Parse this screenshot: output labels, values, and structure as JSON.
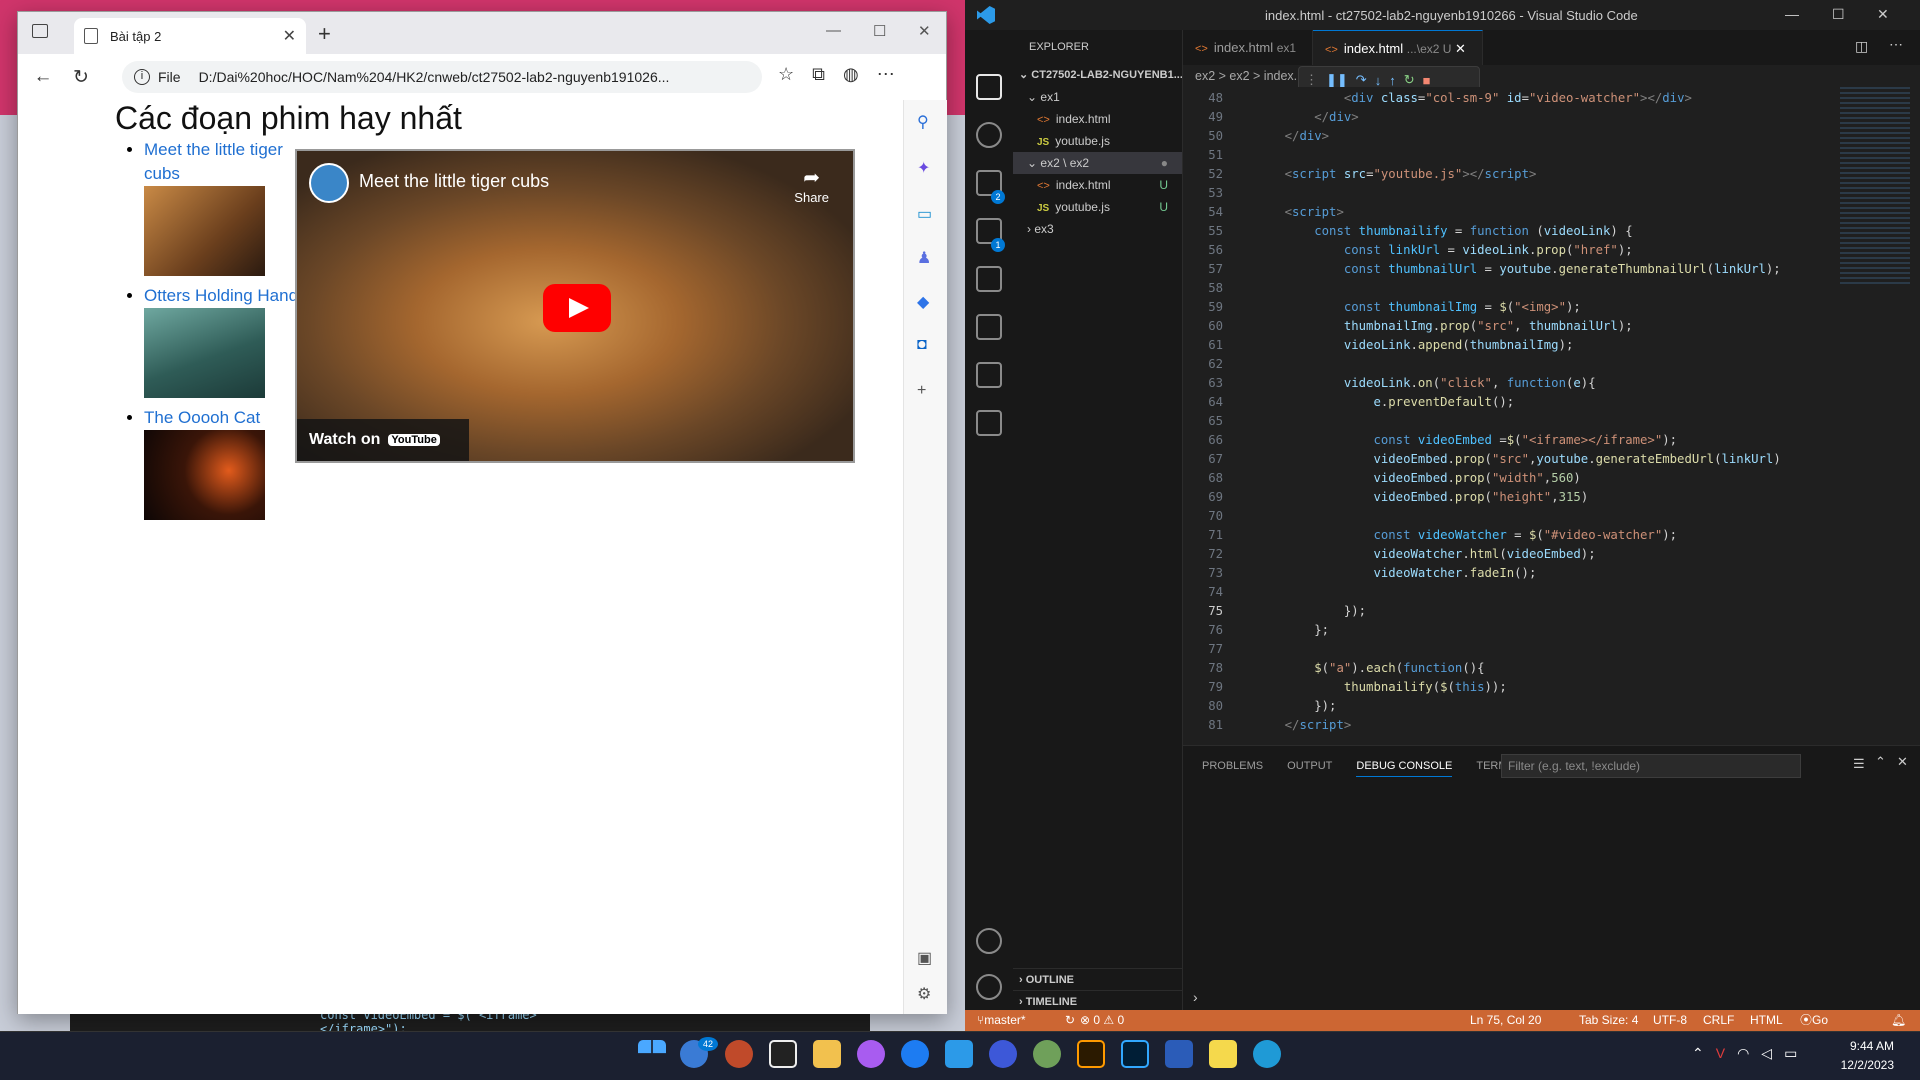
{
  "browser": {
    "tab_title": "Bài tập 2",
    "address_prefix": "File",
    "address_url": "D:/Dai%20hoc/HOC/Nam%204/HK2/cnweb/ct27502-lab2-nguyenb191026...",
    "page": {
      "heading": "Các đoạn phim hay nhất",
      "videos": [
        {
          "title": "Meet the little tiger cubs",
          "thumb_color": "#8a5a2a"
        },
        {
          "title": "Otters Holding Hands",
          "thumb_color": "#4f7f7a"
        },
        {
          "title": "The Ooooh Cat",
          "thumb_color": "#2a1410"
        }
      ],
      "player": {
        "title": "Meet the little tiger cubs",
        "share_label": "Share",
        "watch_on": "Watch on",
        "youtube": "YouTube"
      }
    }
  },
  "vscode": {
    "window_title": "index.html - ct27502-lab2-nguyenb1910266 - Visual Studio Code",
    "explorer_title": "EXPLORER",
    "workspace": "CT27502-LAB2-NGUYENB1...",
    "tree": [
      {
        "label": "ex1",
        "type": "folder"
      },
      {
        "label": "index.html",
        "type": "html"
      },
      {
        "label": "youtube.js",
        "type": "js"
      },
      {
        "label": "ex2 \\ ex2",
        "type": "folder"
      },
      {
        "label": "index.html",
        "type": "html",
        "status": "U"
      },
      {
        "label": "youtube.js",
        "type": "js",
        "status": "U"
      },
      {
        "label": "ex3",
        "type": "folder"
      }
    ],
    "outline": "OUTLINE",
    "timeline": "TIMELINE",
    "tabs": [
      {
        "label": "index.html",
        "hint": "ex1"
      },
      {
        "label": "index.html",
        "hint": "...\\ex2 U"
      }
    ],
    "breadcrumb": "ex2 > ex2 > index.html > html > body > script > th",
    "code_lines": [
      {
        "n": "48",
        "html": "            <span class=\"tg\">&lt;</span><span class=\"tn\">div</span> <span class=\"at\">class</span>=<span class=\"s\">\"col-sm-9\"</span> <span class=\"at\">id</span>=<span class=\"s\">\"video-watcher\"</span><span class=\"tg\">&gt;&lt;/</span><span class=\"tn\">div</span><span class=\"tg\">&gt;</span>"
      },
      {
        "n": "49",
        "html": "        <span class=\"tg\">&lt;/</span><span class=\"tn\">div</span><span class=\"tg\">&gt;</span>"
      },
      {
        "n": "50",
        "html": "    <span class=\"tg\">&lt;/</span><span class=\"tn\">div</span><span class=\"tg\">&gt;</span>"
      },
      {
        "n": "51",
        "html": ""
      },
      {
        "n": "52",
        "html": "    <span class=\"tg\">&lt;</span><span class=\"tn\">script</span> <span class=\"at\">src</span>=<span class=\"s\">\"youtube.js\"</span><span class=\"tg\">&gt;&lt;/</span><span class=\"tn\">script</span><span class=\"tg\">&gt;</span>"
      },
      {
        "n": "53",
        "html": ""
      },
      {
        "n": "54",
        "html": "    <span class=\"tg\">&lt;</span><span class=\"tn\">script</span><span class=\"tg\">&gt;</span>"
      },
      {
        "n": "55",
        "html": "        <span class=\"k\">const</span> <span class=\"fn\">thumbnailify</span> = <span class=\"k\">function</span> (<span class=\"v\">videoLink</span>) {"
      },
      {
        "n": "56",
        "html": "            <span class=\"k\">const</span> <span class=\"fn\">linkUrl</span> = <span class=\"v\">videoLink</span>.<span class=\"f\">prop</span>(<span class=\"s\">\"href\"</span>);"
      },
      {
        "n": "57",
        "html": "            <span class=\"k\">const</span> <span class=\"fn\">thumbnailUrl</span> = <span class=\"v\">youtube</span>.<span class=\"f\">generateThumbnailUrl</span>(<span class=\"v\">linkUrl</span>);"
      },
      {
        "n": "58",
        "html": ""
      },
      {
        "n": "59",
        "html": "            <span class=\"k\">const</span> <span class=\"fn\">thumbnailImg</span> = <span class=\"f\">$</span>(<span class=\"s\">\"&lt;img&gt;\"</span>);"
      },
      {
        "n": "60",
        "html": "            <span class=\"v\">thumbnailImg</span>.<span class=\"f\">prop</span>(<span class=\"s\">\"src\"</span>, <span class=\"v\">thumbnailUrl</span>);"
      },
      {
        "n": "61",
        "html": "            <span class=\"v\">videoLink</span>.<span class=\"f\">append</span>(<span class=\"v\">thumbnailImg</span>);"
      },
      {
        "n": "62",
        "html": ""
      },
      {
        "n": "63",
        "html": "            <span class=\"v\">videoLink</span>.<span class=\"f\">on</span>(<span class=\"s\">\"click\"</span>, <span class=\"k\">function</span>(<span class=\"v\">e</span>){"
      },
      {
        "n": "64",
        "html": "                <span class=\"v\">e</span>.<span class=\"f\">preventDefault</span>();"
      },
      {
        "n": "65",
        "html": ""
      },
      {
        "n": "66",
        "html": "                <span class=\"k\">const</span> <span class=\"fn\">videoEmbed</span> =<span class=\"f\">$</span>(<span class=\"s\">\"&lt;iframe&gt;&lt;/iframe&gt;\"</span>);"
      },
      {
        "n": "67",
        "html": "                <span class=\"v\">videoEmbed</span>.<span class=\"f\">prop</span>(<span class=\"s\">\"src\"</span>,<span class=\"v\">youtube</span>.<span class=\"f\">generateEmbedUrl</span>(<span class=\"v\">linkUrl</span>)"
      },
      {
        "n": "68",
        "html": "                <span class=\"v\">videoEmbed</span>.<span class=\"f\">prop</span>(<span class=\"s\">\"width\"</span>,<span class=\"n\">560</span>)"
      },
      {
        "n": "69",
        "html": "                <span class=\"v\">videoEmbed</span>.<span class=\"f\">prop</span>(<span class=\"s\">\"height\"</span>,<span class=\"n\">315</span>)"
      },
      {
        "n": "70",
        "html": ""
      },
      {
        "n": "71",
        "html": "                <span class=\"k\">const</span> <span class=\"fn\">videoWatcher</span> = <span class=\"f\">$</span>(<span class=\"s\">\"#video-watcher\"</span>);"
      },
      {
        "n": "72",
        "html": "                <span class=\"v\">videoWatcher</span>.<span class=\"f\">html</span>(<span class=\"v\">videoEmbed</span>);"
      },
      {
        "n": "73",
        "html": "                <span class=\"v\">videoWatcher</span>.<span class=\"f\">fadeIn</span>();"
      },
      {
        "n": "74",
        "html": ""
      },
      {
        "n": "75",
        "html": "            });"
      },
      {
        "n": "76",
        "html": "        };"
      },
      {
        "n": "77",
        "html": ""
      },
      {
        "n": "78",
        "html": "        <span class=\"f\">$</span>(<span class=\"s\">\"a\"</span>).<span class=\"f\">each</span>(<span class=\"k\">function</span>(){"
      },
      {
        "n": "79",
        "html": "            <span class=\"f\">thumbnailify</span>(<span class=\"f\">$</span>(<span class=\"k\">this</span>));"
      },
      {
        "n": "80",
        "html": "        });"
      },
      {
        "n": "81",
        "html": "    <span class=\"tg\">&lt;/</span><span class=\"tn\">script</span><span class=\"tg\">&gt;</span>"
      }
    ],
    "current_line": "75",
    "panel_tabs": [
      "PROBLEMS",
      "OUTPUT",
      "DEBUG CONSOLE",
      "TERMINAL"
    ],
    "panel_active": "DEBUG CONSOLE",
    "filter_placeholder": "Filter (e.g. text, !exclude)",
    "status": {
      "branch": "master*",
      "problems": "⊗ 0 ⚠ 0",
      "position": "Ln 75, Col 20",
      "tab_size": "Tab Size: 4",
      "encoding": "UTF-8",
      "eol": "CRLF",
      "language": "HTML",
      "go_live": "Go Live"
    }
  },
  "taskbar": {
    "time": "9:44 AM",
    "date": "12/2/2023",
    "badge": "42"
  }
}
